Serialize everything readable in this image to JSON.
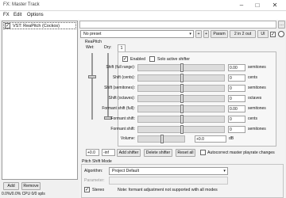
{
  "window": {
    "title": "FX: Master Track"
  },
  "menu": [
    "FX",
    "Edit",
    "Options"
  ],
  "fx_list": {
    "items": [
      {
        "label": "VST: ReaPitch (Cockos)",
        "checked": true
      }
    ]
  },
  "toolbar": {
    "preset": "No preset",
    "plus": "+",
    "param": "Param",
    "io": "2 in 2 out",
    "ui": "UI"
  },
  "reapitch": {
    "group_label": "ReaPitch",
    "wet_label": "Wet:",
    "dry_label": "Dry:",
    "tab": "1",
    "enabled_label": "Enabled",
    "enabled": true,
    "solo_label": "Solo active shifter",
    "solo": false,
    "rows": [
      {
        "label": "Shift (full range):",
        "value": "0.00",
        "unit": "semitones"
      },
      {
        "label": "Shift (cents):",
        "value": "0",
        "unit": "cents"
      },
      {
        "label": "Shift (semitones):",
        "value": "0",
        "unit": "semitones"
      },
      {
        "label": "Shift (octaves):",
        "value": "0",
        "unit": "octaves"
      },
      {
        "label": "Formant shift (full):",
        "value": "0.00",
        "unit": "semitones"
      },
      {
        "label": "Formant shift:",
        "value": "0",
        "unit": "cents"
      },
      {
        "label": "Formant shift:",
        "value": "0",
        "unit": "semitones"
      }
    ],
    "volume_label": "Volume:",
    "volume_value": "+0.0",
    "volume_unit": "dB",
    "wet_value": "+0.0",
    "dry_value": "-inf",
    "add_shifter": "Add shifter",
    "delete_shifter": "Delete shifter",
    "reset_all": "Reset all",
    "autocorrect_label": "Autocorrect master playrate changes",
    "mode_group": "Pitch Shift Mode",
    "algorithm_label": "Algorithm:",
    "algorithm_value": "Project Default",
    "parameter_label": "Parameter:",
    "stereo_label": "Stereo",
    "stereo": true,
    "note": "Note: formant adjustment not supported with all modes"
  },
  "bottom": {
    "add": "Add",
    "remove": "Remove",
    "status": "0.0%/0.0% CPU 0/0 spls"
  }
}
